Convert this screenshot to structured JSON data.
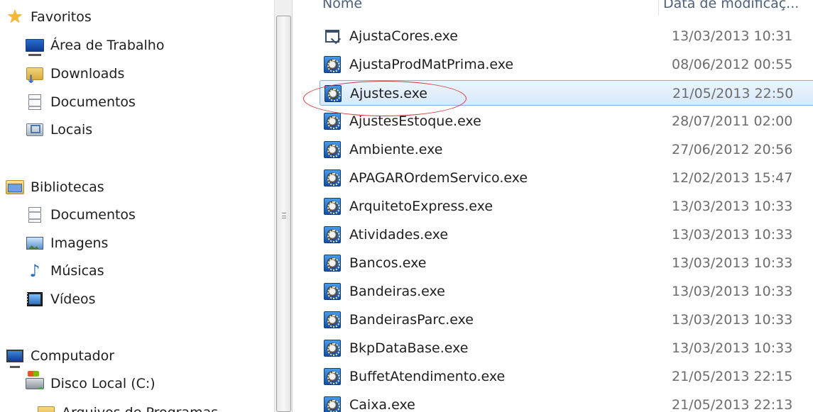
{
  "nav": {
    "favorites": "Favoritos",
    "desktop": "Área de Trabalho",
    "downloads": "Downloads",
    "documents": "Documentos",
    "locais": "Locais",
    "libraries": "Bibliotecas",
    "lib_documents": "Documentos",
    "lib_images": "Imagens",
    "lib_music": "Músicas",
    "lib_videos": "Vídeos",
    "computer": "Computador",
    "local_disk": "Disco Local (C:)",
    "program_files": "Arquivos de Programas"
  },
  "columns": {
    "name": "Nome",
    "date": "Data de modificaç..."
  },
  "files": [
    {
      "name": "AjustaCores.exe",
      "date": "13/03/2013 10:31",
      "icon": "app-window-icon"
    },
    {
      "name": "AjustaProdMatPrima.exe",
      "date": "08/06/2012 00:55",
      "icon": "exe-icon"
    },
    {
      "name": "Ajustes.exe",
      "date": "21/05/2013 22:50",
      "icon": "exe-icon",
      "selected": true
    },
    {
      "name": "AjustesEstoque.exe",
      "date": "28/07/2011 02:00",
      "icon": "exe-icon"
    },
    {
      "name": "Ambiente.exe",
      "date": "27/06/2012 20:56",
      "icon": "exe-icon"
    },
    {
      "name": "APAGAROrdemServico.exe",
      "date": "12/02/2013 15:47",
      "icon": "exe-icon"
    },
    {
      "name": "ArquitetoExpress.exe",
      "date": "13/03/2013 10:33",
      "icon": "exe-icon"
    },
    {
      "name": "Atividades.exe",
      "date": "13/03/2013 10:33",
      "icon": "exe-icon"
    },
    {
      "name": "Bancos.exe",
      "date": "13/03/2013 10:33",
      "icon": "exe-icon"
    },
    {
      "name": "Bandeiras.exe",
      "date": "13/03/2013 10:33",
      "icon": "exe-icon"
    },
    {
      "name": "BandeirasParc.exe",
      "date": "13/03/2013 10:33",
      "icon": "exe-icon"
    },
    {
      "name": "BkpDataBase.exe",
      "date": "13/03/2013 10:33",
      "icon": "exe-icon"
    },
    {
      "name": "BuffetAtendimento.exe",
      "date": "21/05/2013 22:15",
      "icon": "exe-icon"
    },
    {
      "name": "Caixa.exe",
      "date": "21/05/2013 22:13",
      "icon": "exe-icon"
    }
  ],
  "colors": {
    "selection_bg": "#d7e9fb",
    "selection_border": "#84acdd",
    "annotation": "#d23a3a",
    "header_text": "#4c607a"
  }
}
